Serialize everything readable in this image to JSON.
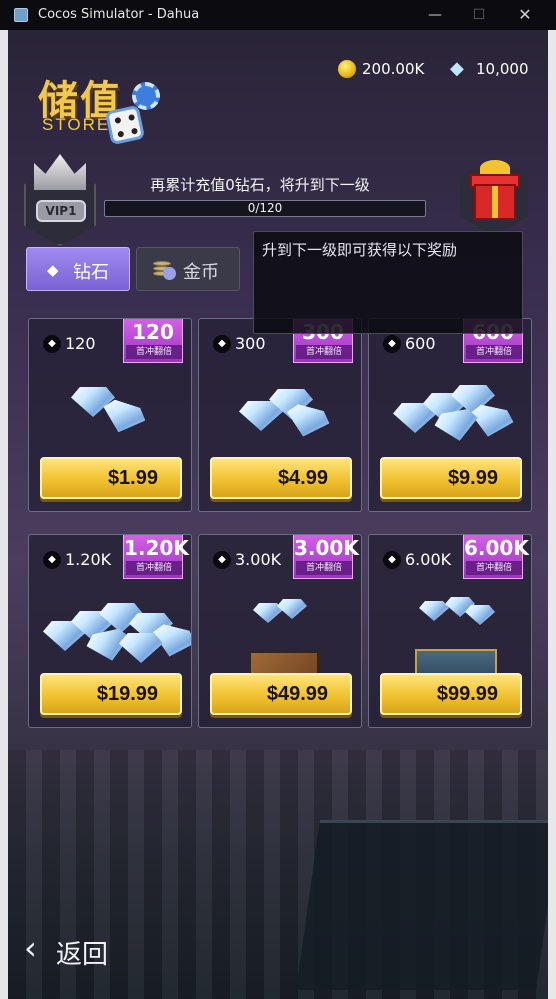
{
  "window": {
    "title": "Cocos Simulator - Dahua",
    "minimize_glyph": "—",
    "maximize_glyph": "☐",
    "close_glyph": "✕"
  },
  "logo": {
    "title_cn": "储值",
    "title_en": "STORE"
  },
  "currency": {
    "gold": "200.00K",
    "diamonds": "10,000"
  },
  "vip": {
    "level": "VIP1"
  },
  "upgrade": {
    "message": "再累计充值0钻石，将升到下一级",
    "progress_label": "0/120",
    "progress": 0
  },
  "tabs": [
    {
      "label": "钻石",
      "active": true
    },
    {
      "label": "金币",
      "active": false
    }
  ],
  "tooltip": {
    "text": "升到下一级即可获得以下奖励"
  },
  "products": [
    {
      "qty": "120",
      "badge": "120",
      "badge_text": "首冲翻倍",
      "price": "$1.99"
    },
    {
      "qty": "300",
      "badge": "300",
      "badge_text": "首冲翻倍",
      "price": "$4.99"
    },
    {
      "qty": "600",
      "badge": "600",
      "badge_text": "首冲翻倍",
      "price": "$9.99"
    },
    {
      "qty": "1.20K",
      "badge": "1.20K",
      "badge_text": "首冲翻倍",
      "price": "$19.99"
    },
    {
      "qty": "3.00K",
      "badge": "3.00K",
      "badge_text": "首冲翻倍",
      "price": "$49.99"
    },
    {
      "qty": "6.00K",
      "badge": "6.00K",
      "badge_text": "首冲翻倍",
      "price": "$99.99"
    }
  ],
  "back": {
    "label": "返回"
  },
  "colors": {
    "accent_purple": "#7a62d4",
    "gold_button": "#f1c230",
    "badge_purple": "#b248d4"
  }
}
